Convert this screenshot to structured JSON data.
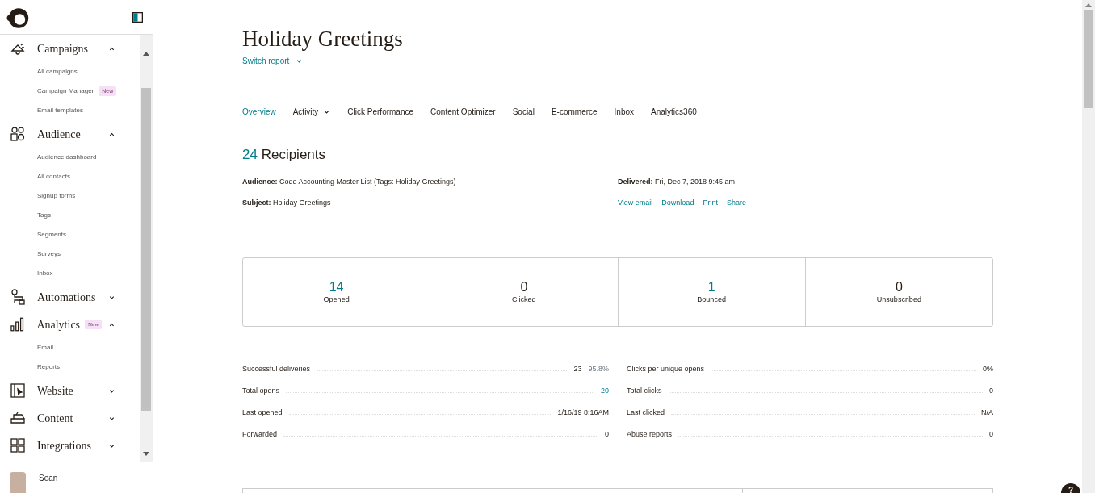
{
  "sidebar": {
    "sections": [
      {
        "label": "Campaigns",
        "expanded": true,
        "children": [
          {
            "label": "All campaigns"
          },
          {
            "label": "Campaign Manager",
            "badge": "New"
          },
          {
            "label": "Email templates"
          }
        ]
      },
      {
        "label": "Audience",
        "expanded": true,
        "children": [
          {
            "label": "Audience dashboard"
          },
          {
            "label": "All contacts"
          },
          {
            "label": "Signup forms"
          },
          {
            "label": "Tags"
          },
          {
            "label": "Segments"
          },
          {
            "label": "Surveys"
          },
          {
            "label": "Inbox"
          }
        ]
      },
      {
        "label": "Automations",
        "expanded": false
      },
      {
        "label": "Analytics",
        "expanded": true,
        "badge": "New",
        "children": [
          {
            "label": "Email"
          },
          {
            "label": "Reports"
          }
        ]
      },
      {
        "label": "Website",
        "expanded": false
      },
      {
        "label": "Content",
        "expanded": false
      },
      {
        "label": "Integrations",
        "expanded": false
      }
    ],
    "user": {
      "name": "Sean"
    }
  },
  "report": {
    "title": "Holiday Greetings",
    "switch_label": "Switch report",
    "tabs": [
      {
        "label": "Overview",
        "selected": true
      },
      {
        "label": "Activity",
        "selected": false,
        "dropdown": true
      },
      {
        "label": "Click Performance",
        "selected": false
      },
      {
        "label": "Content Optimizer",
        "selected": false
      },
      {
        "label": "Social",
        "selected": false
      },
      {
        "label": "E-commerce",
        "selected": false
      },
      {
        "label": "Inbox",
        "selected": false
      },
      {
        "label": "Analytics360",
        "selected": false
      }
    ],
    "recipients_count": "24",
    "recipients_label": "Recipients",
    "details": [
      {
        "label": "Audience:",
        "value": "Code Accounting Master List (Tags: Holiday Greetings)"
      },
      {
        "label": "Delivered:",
        "value": "Fri, Dec 7, 2018 9:45 am"
      },
      {
        "label": "Subject:",
        "value": "Holiday Greetings"
      }
    ],
    "links": [
      "View email",
      "Download",
      "Print",
      "Share"
    ],
    "link_separator": "·",
    "summary": [
      {
        "value": "14",
        "label": "Opened",
        "highlight": true
      },
      {
        "value": "0",
        "label": "Clicked",
        "highlight": false
      },
      {
        "value": "1",
        "label": "Bounced",
        "highlight": true
      },
      {
        "value": "0",
        "label": "Unsubscribed",
        "highlight": false
      }
    ],
    "stats_left": [
      {
        "label": "Successful deliveries",
        "value": "23",
        "extra": "95.8%"
      },
      {
        "label": "Total opens",
        "value": "20",
        "highlight": true
      },
      {
        "label": "Last opened",
        "value": "1/16/19 8:16AM"
      },
      {
        "label": "Forwarded",
        "value": "0"
      }
    ],
    "stats_right": [
      {
        "label": "Clicks per unique opens",
        "value": "0%"
      },
      {
        "label": "Total clicks",
        "value": "0"
      },
      {
        "label": "Last clicked",
        "value": "N/A"
      },
      {
        "label": "Abuse reports",
        "value": "0"
      }
    ]
  },
  "help_button": "?"
}
